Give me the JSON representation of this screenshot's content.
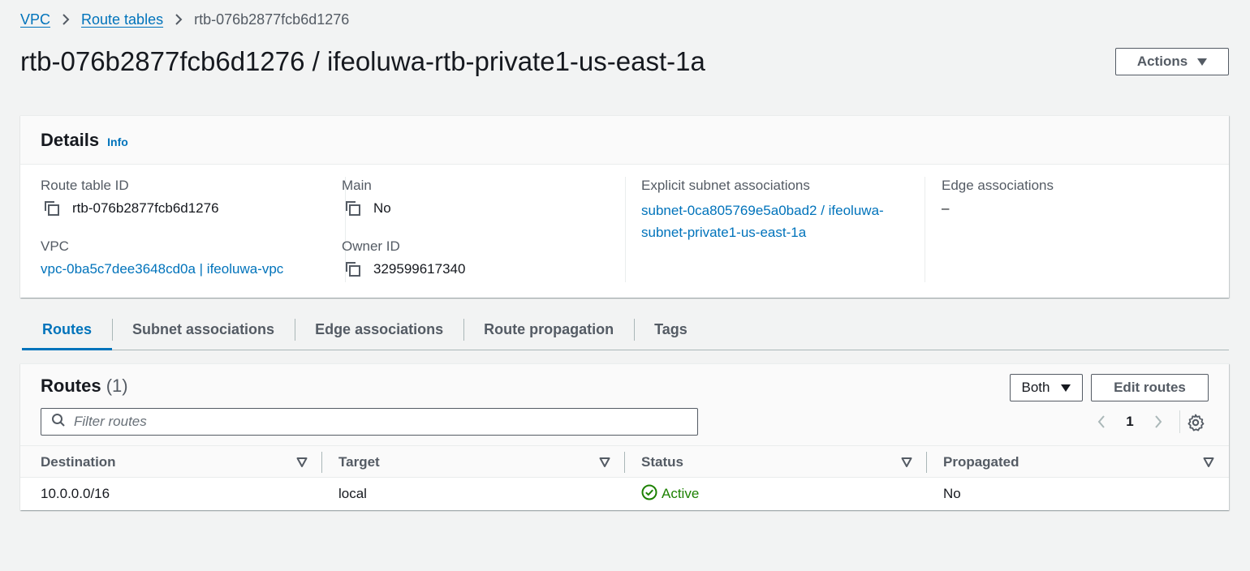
{
  "breadcrumb": {
    "items": [
      "VPC",
      "Route tables"
    ],
    "current": "rtb-076b2877fcb6d1276"
  },
  "page": {
    "title": "rtb-076b2877fcb6d1276 / ifeoluwa-rtb-private1-us-east-1a",
    "actions_label": "Actions"
  },
  "details": {
    "title": "Details",
    "info": "Info",
    "route_table_id_label": "Route table ID",
    "route_table_id": "rtb-076b2877fcb6d1276",
    "vpc_label": "VPC",
    "vpc": "vpc-0ba5c7dee3648cd0a | ifeoluwa-vpc",
    "main_label": "Main",
    "main": "No",
    "owner_id_label": "Owner ID",
    "owner_id": "329599617340",
    "explicit_label": "Explicit subnet associations",
    "explicit_line1": "subnet-0ca805769e5a0bad2 / ifeoluwa-",
    "explicit_line2": "subnet-private1-us-east-1a",
    "edge_label": "Edge associations",
    "edge_value": "–"
  },
  "tabs": [
    "Routes",
    "Subnet associations",
    "Edge associations",
    "Route propagation",
    "Tags"
  ],
  "active_tab": "Routes",
  "routes": {
    "title": "Routes",
    "count": "(1)",
    "filter_select": "Both",
    "edit_label": "Edit routes",
    "filter_placeholder": "Filter routes",
    "page_number": "1",
    "columns": [
      "Destination",
      "Target",
      "Status",
      "Propagated"
    ],
    "rows": [
      {
        "destination": "10.0.0.0/16",
        "target": "local",
        "status": "Active",
        "propagated": "No"
      }
    ]
  },
  "colors": {
    "link": "#0073bb",
    "success": "#1d8102",
    "background": "#f2f3f3"
  },
  "icons": [
    "chevron-right-icon",
    "caret-down-icon",
    "copy-icon",
    "search-icon",
    "chevron-left-icon",
    "settings-gear-icon",
    "sort-icon",
    "status-success-icon"
  ]
}
